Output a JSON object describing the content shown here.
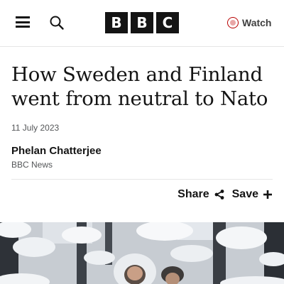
{
  "header": {
    "logo_letters": [
      "B",
      "B",
      "C"
    ],
    "watch_label": "Watch"
  },
  "article": {
    "title": "How Sweden and Finland went from neutral to Nato",
    "date": "11 July 2023",
    "author": "Phelan Chatterjee",
    "organization": "BBC News",
    "share_label": "Share",
    "save_label": "Save"
  },
  "icons": {
    "menu": "menu-icon",
    "search": "search-icon",
    "watch": "live-dot-icon",
    "share": "share-icon",
    "save": "plus-icon"
  },
  "colors": {
    "text": "#141414",
    "muted": "#545658",
    "brand_red": "#b80000"
  }
}
